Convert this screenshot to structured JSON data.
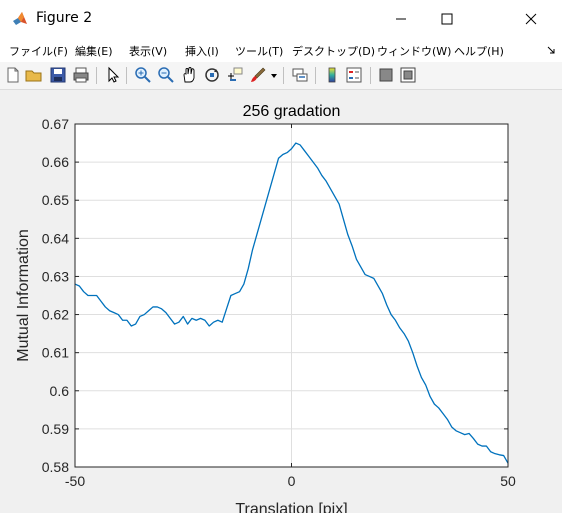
{
  "window": {
    "title": "Figure 2",
    "controls": {
      "minimize": "—",
      "maximize": "☐",
      "close": "✕"
    }
  },
  "menu": {
    "items": [
      "ファイル(F)",
      "編集(E)",
      "表示(V)",
      "挿入(I)",
      "ツール(T)",
      "デスクトップ(D)",
      "ウィンドウ(W)",
      "ヘルプ(H)"
    ],
    "overflow_icon": "dock-arrow-icon"
  },
  "toolbar": {
    "icons": [
      "new-figure-icon",
      "open-file-icon",
      "save-icon",
      "print-icon",
      "select-arrow-icon",
      "zoom-in-icon",
      "zoom-out-icon",
      "pan-hand-icon",
      "rotate-3d-icon",
      "data-cursor-icon",
      "brush-icon",
      "link-plot-icon",
      "colorbar-icon",
      "legend-icon",
      "hide-plot-tools-icon",
      "show-plot-tools-icon"
    ]
  },
  "colors": {
    "line": "#0072bd",
    "grid": "#dfdfdf",
    "axes_bg": "#ffffff",
    "figure_bg": "#f0f0f0"
  },
  "chart_data": {
    "type": "line",
    "title": "256 gradation",
    "xlabel": "Translation [pix]",
    "ylabel": "Mutual Information",
    "xlim": [
      -50,
      50
    ],
    "ylim": [
      0.58,
      0.67
    ],
    "xticks": [
      "-50",
      "0",
      "50"
    ],
    "yticks": [
      "0.58",
      "0.59",
      "0.6",
      "0.61",
      "0.62",
      "0.63",
      "0.64",
      "0.65",
      "0.66",
      "0.67"
    ],
    "grid": true,
    "series": [
      {
        "x": [
          -50,
          -49,
          -48,
          -47,
          -46,
          -45,
          -44,
          -43,
          -42,
          -41,
          -40,
          -39,
          -38,
          -37,
          -36,
          -35,
          -34,
          -33,
          -32,
          -31,
          -30,
          -29,
          -28,
          -27,
          -26,
          -25,
          -24,
          -23,
          -22,
          -21,
          -20,
          -19,
          -18,
          -17,
          -16,
          -15,
          -14,
          -13,
          -12,
          -11,
          -10,
          -9,
          -8,
          -7,
          -6,
          -5,
          -4,
          -3,
          -2,
          -1,
          0,
          1,
          2,
          3,
          4,
          5,
          6,
          7,
          8,
          9,
          10,
          11,
          12,
          13,
          14,
          15,
          16,
          17,
          18,
          19,
          20,
          21,
          22,
          23,
          24,
          25,
          26,
          27,
          28,
          29,
          30,
          31,
          32,
          33,
          34,
          35,
          36,
          37,
          38,
          39,
          40,
          41,
          42,
          43,
          44,
          45,
          46,
          47,
          48,
          49,
          50
        ],
        "y": [
          0.628,
          0.6275,
          0.626,
          0.625,
          0.625,
          0.625,
          0.6235,
          0.622,
          0.621,
          0.6205,
          0.62,
          0.6185,
          0.6185,
          0.617,
          0.6175,
          0.6195,
          0.62,
          0.621,
          0.622,
          0.622,
          0.6215,
          0.6205,
          0.619,
          0.6175,
          0.618,
          0.6195,
          0.6175,
          0.619,
          0.6185,
          0.619,
          0.6185,
          0.617,
          0.618,
          0.6185,
          0.618,
          0.6215,
          0.625,
          0.6255,
          0.626,
          0.628,
          0.632,
          0.637,
          0.641,
          0.645,
          0.649,
          0.653,
          0.657,
          0.661,
          0.662,
          0.6625,
          0.6635,
          0.665,
          0.6645,
          0.663,
          0.6615,
          0.66,
          0.6585,
          0.6565,
          0.655,
          0.653,
          0.651,
          0.649,
          0.645,
          0.641,
          0.638,
          0.6345,
          0.6325,
          0.6305,
          0.63,
          0.6295,
          0.6275,
          0.6255,
          0.6225,
          0.62,
          0.6185,
          0.6165,
          0.615,
          0.613,
          0.61,
          0.6065,
          0.6035,
          0.6015,
          0.5985,
          0.5965,
          0.5955,
          0.594,
          0.5925,
          0.5905,
          0.5895,
          0.589,
          0.5885,
          0.5888,
          0.5875,
          0.586,
          0.5855,
          0.5855,
          0.584,
          0.5835,
          0.5832,
          0.583,
          0.581
        ]
      }
    ]
  }
}
